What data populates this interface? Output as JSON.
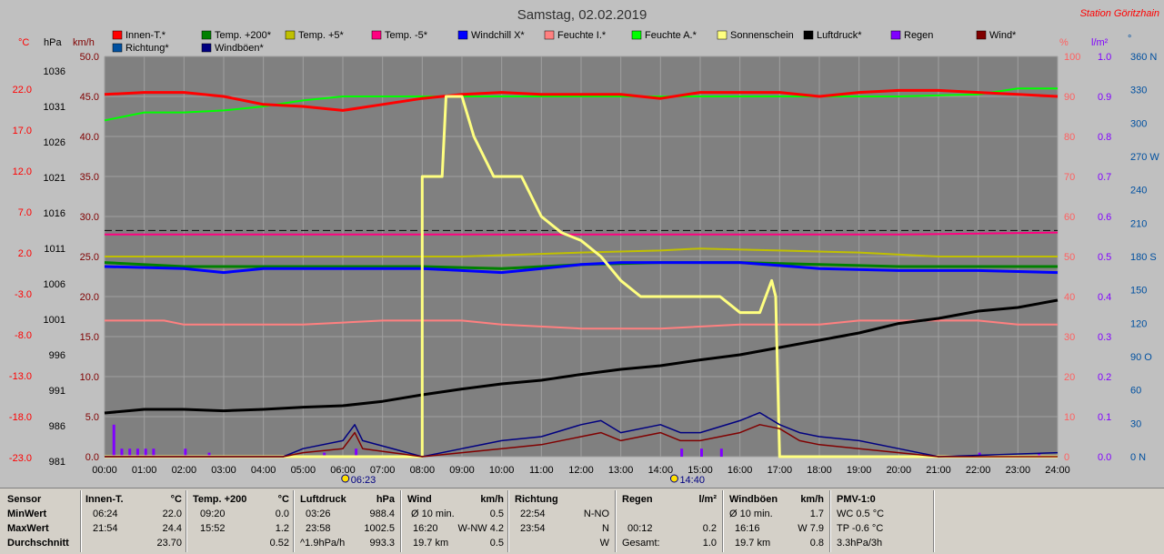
{
  "chart_data": {
    "type": "line",
    "title": "Samstag, 02.02.2019",
    "station": "Station Göritzhain",
    "legend": [
      {
        "name": "Innen-T.*",
        "color": "#ff0000"
      },
      {
        "name": "Temp. +200*",
        "color": "#008000"
      },
      {
        "name": "Temp. +5*",
        "color": "#c0c000"
      },
      {
        "name": "Temp. -5*",
        "color": "#ff0080"
      },
      {
        "name": "Windchill X*",
        "color": "#0000ff"
      },
      {
        "name": "Feuchte I.*",
        "color": "#ff8080"
      },
      {
        "name": "Feuchte A.*",
        "color": "#00ff00"
      },
      {
        "name": "Sonnenschein",
        "color": "#ffff80"
      },
      {
        "name": "Luftdruck*",
        "color": "#000000"
      },
      {
        "name": "Regen",
        "color": "#8000ff"
      },
      {
        "name": "Wind*",
        "color": "#800000"
      },
      {
        "name": "Richtung*",
        "color": "#0050a0"
      },
      {
        "name": "Windböen*",
        "color": "#000080"
      }
    ],
    "axis_units": {
      "temp": "°C",
      "press": "hPa",
      "wind": "km/h",
      "hum": "%",
      "rain": "l/m²",
      "dir": "°"
    },
    "temp_ticks": [
      "22.0",
      "17.0",
      "12.0",
      "7.0",
      "2.0",
      "-3.0",
      "-8.0",
      "-13.0",
      "-18.0",
      "-23.0"
    ],
    "press_ticks": [
      "1036",
      "1031",
      "1026",
      "1021",
      "1016",
      "1011",
      "1006",
      "1001",
      "996",
      "991",
      "986",
      "981"
    ],
    "wind_ticks": [
      "50.0",
      "45.0",
      "40.0",
      "35.0",
      "30.0",
      "25.0",
      "20.0",
      "15.0",
      "10.0",
      "5.0",
      "0.0"
    ],
    "hum_ticks": [
      "100",
      "90",
      "80",
      "70",
      "60",
      "50",
      "40",
      "30",
      "20",
      "10",
      "0"
    ],
    "rain_ticks": [
      "1.0",
      "0.9",
      "0.8",
      "0.7",
      "0.6",
      "0.5",
      "0.4",
      "0.3",
      "0.2",
      "0.1",
      "0.0"
    ],
    "dir_ticks": [
      "360 N",
      "330",
      "300",
      "270 W",
      "240",
      "210",
      "180 S",
      "150",
      "120",
      "90 O",
      "60",
      "30",
      "0 N"
    ],
    "x_ticks": [
      "00:00",
      "01:00",
      "02:00",
      "03:00",
      "04:00",
      "05:00",
      "06:00",
      "07:00",
      "08:00",
      "09:00",
      "10:00",
      "11:00",
      "12:00",
      "13:00",
      "14:00",
      "15:00",
      "16:00",
      "17:00",
      "18:00",
      "19:00",
      "20:00",
      "21:00",
      "22:00",
      "23:00",
      "24:00"
    ],
    "sunrise": "06:23",
    "solar_noon_marker": "14:40",
    "series": {
      "innen_t_hum": [
        [
          0,
          90.5
        ],
        [
          1,
          91
        ],
        [
          2,
          91
        ],
        [
          3,
          90
        ],
        [
          4,
          88
        ],
        [
          5,
          87.5
        ],
        [
          6,
          86.5
        ],
        [
          7,
          88
        ],
        [
          8,
          89.5
        ],
        [
          9,
          90.5
        ],
        [
          10,
          91
        ],
        [
          11,
          90.5
        ],
        [
          12,
          90.5
        ],
        [
          13,
          90.5
        ],
        [
          14,
          89.5
        ],
        [
          15,
          91
        ],
        [
          16,
          91
        ],
        [
          17,
          91
        ],
        [
          18,
          90
        ],
        [
          19,
          91
        ],
        [
          20,
          91.5
        ],
        [
          21,
          91.5
        ],
        [
          22,
          91
        ],
        [
          23,
          90.5
        ],
        [
          24,
          90
        ]
      ],
      "feuchte_a_hum": [
        [
          0,
          84
        ],
        [
          0.5,
          85
        ],
        [
          1,
          86
        ],
        [
          2,
          86
        ],
        [
          3,
          86.5
        ],
        [
          4,
          87.5
        ],
        [
          5,
          89
        ],
        [
          6,
          90
        ],
        [
          8,
          90
        ],
        [
          12,
          90
        ],
        [
          16,
          90
        ],
        [
          20,
          90
        ],
        [
          22,
          90.5
        ],
        [
          23,
          92
        ],
        [
          24,
          92
        ]
      ],
      "temp5_hum": [
        [
          0,
          50
        ],
        [
          3,
          50
        ],
        [
          6,
          50
        ],
        [
          9,
          50
        ],
        [
          12,
          51
        ],
        [
          14,
          51.5
        ],
        [
          15,
          52
        ],
        [
          17,
          51.5
        ],
        [
          19,
          51
        ],
        [
          21,
          50
        ],
        [
          24,
          50
        ]
      ],
      "temp200_hum": [
        [
          0,
          48.5
        ],
        [
          2,
          47.5
        ],
        [
          4,
          47.5
        ],
        [
          6,
          47.5
        ],
        [
          8,
          47.5
        ],
        [
          10,
          47
        ],
        [
          12,
          48
        ],
        [
          14,
          48.5
        ],
        [
          16,
          48.5
        ],
        [
          18,
          48
        ],
        [
          20,
          47.5
        ],
        [
          22,
          47.5
        ],
        [
          24,
          47.5
        ]
      ],
      "windchill_hum": [
        [
          0,
          47.5
        ],
        [
          2,
          47
        ],
        [
          3,
          46
        ],
        [
          4,
          47
        ],
        [
          6,
          47
        ],
        [
          8,
          47
        ],
        [
          9,
          46.5
        ],
        [
          10,
          46
        ],
        [
          11,
          47
        ],
        [
          12,
          48
        ],
        [
          13,
          48.5
        ],
        [
          14,
          48.5
        ],
        [
          16,
          48.5
        ],
        [
          18,
          47
        ],
        [
          20,
          46.5
        ],
        [
          22,
          46.5
        ],
        [
          24,
          46
        ]
      ],
      "temp_minus5_hum": [
        [
          0,
          55.5
        ],
        [
          4,
          55.5
        ],
        [
          8,
          55.5
        ],
        [
          12,
          55.5
        ],
        [
          16,
          55.5
        ],
        [
          20,
          55.5
        ],
        [
          24,
          56
        ]
      ],
      "feuchte_i_hum": [
        [
          0,
          34
        ],
        [
          1.5,
          34
        ],
        [
          2,
          33
        ],
        [
          3,
          33
        ],
        [
          5,
          33
        ],
        [
          6,
          33.5
        ],
        [
          7,
          34
        ],
        [
          8,
          34
        ],
        [
          9,
          34
        ],
        [
          10,
          33
        ],
        [
          12,
          32
        ],
        [
          14,
          32
        ],
        [
          16,
          33
        ],
        [
          17,
          33
        ],
        [
          18,
          33
        ],
        [
          19,
          34
        ],
        [
          20,
          34
        ],
        [
          22,
          34
        ],
        [
          23,
          33
        ],
        [
          24,
          33
        ]
      ],
      "luftdruck_hpa": [
        [
          0,
          987
        ],
        [
          1,
          987.5
        ],
        [
          2,
          987.5
        ],
        [
          3,
          987.3
        ],
        [
          4,
          987.5
        ],
        [
          5,
          987.8
        ],
        [
          6,
          988
        ],
        [
          7,
          988.6
        ],
        [
          8,
          989.5
        ],
        [
          9,
          990.3
        ],
        [
          10,
          991
        ],
        [
          11,
          991.5
        ],
        [
          12,
          992.3
        ],
        [
          13,
          993
        ],
        [
          14,
          993.5
        ],
        [
          15,
          994.3
        ],
        [
          16,
          995
        ],
        [
          17,
          996
        ],
        [
          18,
          997
        ],
        [
          19,
          998
        ],
        [
          20,
          999.3
        ],
        [
          21,
          1000
        ],
        [
          22,
          1001
        ],
        [
          23,
          1001.5
        ],
        [
          24,
          1002.5
        ]
      ],
      "sonnenschein_kmh": [
        [
          0,
          0
        ],
        [
          8,
          0
        ],
        [
          8,
          35
        ],
        [
          8.5,
          35
        ],
        [
          8.6,
          45
        ],
        [
          9,
          45
        ],
        [
          9.3,
          40
        ],
        [
          9.8,
          35
        ],
        [
          10.5,
          35
        ],
        [
          11,
          30
        ],
        [
          11.5,
          28
        ],
        [
          12,
          27
        ],
        [
          12.5,
          25
        ],
        [
          13,
          22
        ],
        [
          13.5,
          20
        ],
        [
          14,
          20
        ],
        [
          14.5,
          20
        ],
        [
          15,
          20
        ],
        [
          15.5,
          20
        ],
        [
          16,
          18
        ],
        [
          16.5,
          18
        ],
        [
          16.8,
          22
        ],
        [
          16.9,
          20
        ],
        [
          17,
          0
        ],
        [
          24,
          0
        ]
      ],
      "wind_kmh": [
        [
          0,
          0
        ],
        [
          4.5,
          0
        ],
        [
          5,
          0.5
        ],
        [
          6,
          1
        ],
        [
          6.3,
          3
        ],
        [
          6.5,
          1
        ],
        [
          8,
          0
        ],
        [
          9,
          0.5
        ],
        [
          10,
          1
        ],
        [
          11,
          1.5
        ],
        [
          12,
          2.5
        ],
        [
          12.5,
          3
        ],
        [
          13,
          2
        ],
        [
          14,
          3
        ],
        [
          14.5,
          2
        ],
        [
          15,
          2
        ],
        [
          16,
          3
        ],
        [
          16.5,
          4
        ],
        [
          17,
          3.5
        ],
        [
          17.5,
          2
        ],
        [
          18,
          1.5
        ],
        [
          19,
          1
        ],
        [
          20,
          0.5
        ],
        [
          21,
          0
        ],
        [
          24,
          0
        ]
      ],
      "windboen_kmh": [
        [
          0,
          0
        ],
        [
          4.5,
          0
        ],
        [
          5,
          1
        ],
        [
          6,
          2
        ],
        [
          6.3,
          4
        ],
        [
          6.5,
          2
        ],
        [
          8,
          0
        ],
        [
          9,
          1
        ],
        [
          10,
          2
        ],
        [
          11,
          2.5
        ],
        [
          12,
          4
        ],
        [
          12.5,
          4.5
        ],
        [
          13,
          3
        ],
        [
          14,
          4
        ],
        [
          14.5,
          3
        ],
        [
          15,
          3
        ],
        [
          16,
          4.5
        ],
        [
          16.5,
          5.5
        ],
        [
          17,
          4
        ],
        [
          17.5,
          3
        ],
        [
          18,
          2.5
        ],
        [
          19,
          2
        ],
        [
          20,
          1
        ],
        [
          21,
          0
        ],
        [
          24,
          0.5
        ]
      ],
      "regen_lm2": [
        [
          0.2,
          0.08
        ],
        [
          0.4,
          0.02
        ],
        [
          0.6,
          0.02
        ],
        [
          0.8,
          0.02
        ],
        [
          1,
          0.02
        ],
        [
          1.2,
          0.02
        ],
        [
          2,
          0.02
        ],
        [
          2.6,
          0.01
        ],
        [
          5.5,
          0.01
        ],
        [
          6.3,
          0.02
        ],
        [
          14.5,
          0.02
        ],
        [
          15,
          0.02
        ],
        [
          15.5,
          0.02
        ],
        [
          22,
          0.01
        ],
        [
          23.5,
          0.01
        ]
      ]
    }
  },
  "stats": {
    "sensor": {
      "header": "Sensor",
      "rows": [
        "MinWert",
        "MaxWert",
        "Durchschnitt"
      ]
    },
    "innen": {
      "header": "Innen-T.",
      "unit": "°C",
      "rows": [
        [
          "06:24",
          "22.0"
        ],
        [
          "21:54",
          "24.4"
        ],
        [
          "",
          "23.70"
        ]
      ]
    },
    "temp200": {
      "header": "Temp. +200",
      "unit": "°C",
      "rows": [
        [
          "09:20",
          "0.0"
        ],
        [
          "15:52",
          "1.2"
        ],
        [
          "",
          "0.52"
        ]
      ]
    },
    "luftdruck": {
      "header": "Luftdruck",
      "unit": "hPa",
      "rows": [
        [
          "03:26",
          "988.4"
        ],
        [
          "23:58",
          "1002.5"
        ],
        [
          "^1.9hPa/h",
          "993.3"
        ]
      ]
    },
    "wind": {
      "header": "Wind",
      "unit": "km/h",
      "rows": [
        [
          "Ø 10 min.",
          "0.5"
        ],
        [
          "16:20",
          "W-NW 4.2"
        ],
        [
          "19.7 km",
          "0.5"
        ]
      ]
    },
    "richtung": {
      "header": "Richtung",
      "unit": "",
      "rows": [
        [
          "22:54",
          "N-NO"
        ],
        [
          "23:54",
          "N"
        ],
        [
          "",
          "W"
        ]
      ]
    },
    "regen": {
      "header": "Regen",
      "unit": "l/m²",
      "rows": [
        [
          "",
          ""
        ],
        [
          "00:12",
          "0.2"
        ],
        [
          "Gesamt:",
          "1.0"
        ]
      ]
    },
    "windboen": {
      "header": "Windböen",
      "unit": "km/h",
      "rows": [
        [
          "Ø 10 min.",
          "1.7"
        ],
        [
          "16:16",
          "W 7.9"
        ],
        [
          "19.7 km",
          "0.8"
        ]
      ]
    },
    "pmv": {
      "header": "PMV-1:0",
      "rows": [
        "WC 0.5 °C",
        "TP -0.6 °C",
        "3.3hPa/3h"
      ]
    }
  }
}
